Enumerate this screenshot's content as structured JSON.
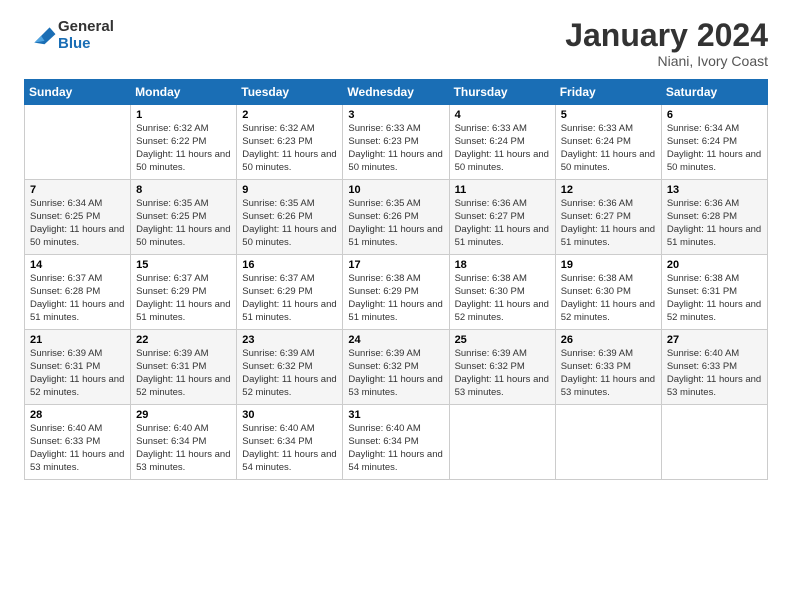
{
  "logo": {
    "general": "General",
    "blue": "Blue"
  },
  "header": {
    "month_year": "January 2024",
    "location": "Niani, Ivory Coast"
  },
  "weekdays": [
    "Sunday",
    "Monday",
    "Tuesday",
    "Wednesday",
    "Thursday",
    "Friday",
    "Saturday"
  ],
  "weeks": [
    [
      {
        "day": "",
        "sunrise": "",
        "sunset": "",
        "daylight": ""
      },
      {
        "day": "1",
        "sunrise": "Sunrise: 6:32 AM",
        "sunset": "Sunset: 6:22 PM",
        "daylight": "Daylight: 11 hours and 50 minutes."
      },
      {
        "day": "2",
        "sunrise": "Sunrise: 6:32 AM",
        "sunset": "Sunset: 6:23 PM",
        "daylight": "Daylight: 11 hours and 50 minutes."
      },
      {
        "day": "3",
        "sunrise": "Sunrise: 6:33 AM",
        "sunset": "Sunset: 6:23 PM",
        "daylight": "Daylight: 11 hours and 50 minutes."
      },
      {
        "day": "4",
        "sunrise": "Sunrise: 6:33 AM",
        "sunset": "Sunset: 6:24 PM",
        "daylight": "Daylight: 11 hours and 50 minutes."
      },
      {
        "day": "5",
        "sunrise": "Sunrise: 6:33 AM",
        "sunset": "Sunset: 6:24 PM",
        "daylight": "Daylight: 11 hours and 50 minutes."
      },
      {
        "day": "6",
        "sunrise": "Sunrise: 6:34 AM",
        "sunset": "Sunset: 6:24 PM",
        "daylight": "Daylight: 11 hours and 50 minutes."
      }
    ],
    [
      {
        "day": "7",
        "sunrise": "Sunrise: 6:34 AM",
        "sunset": "Sunset: 6:25 PM",
        "daylight": "Daylight: 11 hours and 50 minutes."
      },
      {
        "day": "8",
        "sunrise": "Sunrise: 6:35 AM",
        "sunset": "Sunset: 6:25 PM",
        "daylight": "Daylight: 11 hours and 50 minutes."
      },
      {
        "day": "9",
        "sunrise": "Sunrise: 6:35 AM",
        "sunset": "Sunset: 6:26 PM",
        "daylight": "Daylight: 11 hours and 50 minutes."
      },
      {
        "day": "10",
        "sunrise": "Sunrise: 6:35 AM",
        "sunset": "Sunset: 6:26 PM",
        "daylight": "Daylight: 11 hours and 51 minutes."
      },
      {
        "day": "11",
        "sunrise": "Sunrise: 6:36 AM",
        "sunset": "Sunset: 6:27 PM",
        "daylight": "Daylight: 11 hours and 51 minutes."
      },
      {
        "day": "12",
        "sunrise": "Sunrise: 6:36 AM",
        "sunset": "Sunset: 6:27 PM",
        "daylight": "Daylight: 11 hours and 51 minutes."
      },
      {
        "day": "13",
        "sunrise": "Sunrise: 6:36 AM",
        "sunset": "Sunset: 6:28 PM",
        "daylight": "Daylight: 11 hours and 51 minutes."
      }
    ],
    [
      {
        "day": "14",
        "sunrise": "Sunrise: 6:37 AM",
        "sunset": "Sunset: 6:28 PM",
        "daylight": "Daylight: 11 hours and 51 minutes."
      },
      {
        "day": "15",
        "sunrise": "Sunrise: 6:37 AM",
        "sunset": "Sunset: 6:29 PM",
        "daylight": "Daylight: 11 hours and 51 minutes."
      },
      {
        "day": "16",
        "sunrise": "Sunrise: 6:37 AM",
        "sunset": "Sunset: 6:29 PM",
        "daylight": "Daylight: 11 hours and 51 minutes."
      },
      {
        "day": "17",
        "sunrise": "Sunrise: 6:38 AM",
        "sunset": "Sunset: 6:29 PM",
        "daylight": "Daylight: 11 hours and 51 minutes."
      },
      {
        "day": "18",
        "sunrise": "Sunrise: 6:38 AM",
        "sunset": "Sunset: 6:30 PM",
        "daylight": "Daylight: 11 hours and 52 minutes."
      },
      {
        "day": "19",
        "sunrise": "Sunrise: 6:38 AM",
        "sunset": "Sunset: 6:30 PM",
        "daylight": "Daylight: 11 hours and 52 minutes."
      },
      {
        "day": "20",
        "sunrise": "Sunrise: 6:38 AM",
        "sunset": "Sunset: 6:31 PM",
        "daylight": "Daylight: 11 hours and 52 minutes."
      }
    ],
    [
      {
        "day": "21",
        "sunrise": "Sunrise: 6:39 AM",
        "sunset": "Sunset: 6:31 PM",
        "daylight": "Daylight: 11 hours and 52 minutes."
      },
      {
        "day": "22",
        "sunrise": "Sunrise: 6:39 AM",
        "sunset": "Sunset: 6:31 PM",
        "daylight": "Daylight: 11 hours and 52 minutes."
      },
      {
        "day": "23",
        "sunrise": "Sunrise: 6:39 AM",
        "sunset": "Sunset: 6:32 PM",
        "daylight": "Daylight: 11 hours and 52 minutes."
      },
      {
        "day": "24",
        "sunrise": "Sunrise: 6:39 AM",
        "sunset": "Sunset: 6:32 PM",
        "daylight": "Daylight: 11 hours and 53 minutes."
      },
      {
        "day": "25",
        "sunrise": "Sunrise: 6:39 AM",
        "sunset": "Sunset: 6:32 PM",
        "daylight": "Daylight: 11 hours and 53 minutes."
      },
      {
        "day": "26",
        "sunrise": "Sunrise: 6:39 AM",
        "sunset": "Sunset: 6:33 PM",
        "daylight": "Daylight: 11 hours and 53 minutes."
      },
      {
        "day": "27",
        "sunrise": "Sunrise: 6:40 AM",
        "sunset": "Sunset: 6:33 PM",
        "daylight": "Daylight: 11 hours and 53 minutes."
      }
    ],
    [
      {
        "day": "28",
        "sunrise": "Sunrise: 6:40 AM",
        "sunset": "Sunset: 6:33 PM",
        "daylight": "Daylight: 11 hours and 53 minutes."
      },
      {
        "day": "29",
        "sunrise": "Sunrise: 6:40 AM",
        "sunset": "Sunset: 6:34 PM",
        "daylight": "Daylight: 11 hours and 53 minutes."
      },
      {
        "day": "30",
        "sunrise": "Sunrise: 6:40 AM",
        "sunset": "Sunset: 6:34 PM",
        "daylight": "Daylight: 11 hours and 54 minutes."
      },
      {
        "day": "31",
        "sunrise": "Sunrise: 6:40 AM",
        "sunset": "Sunset: 6:34 PM",
        "daylight": "Daylight: 11 hours and 54 minutes."
      },
      {
        "day": "",
        "sunrise": "",
        "sunset": "",
        "daylight": ""
      },
      {
        "day": "",
        "sunrise": "",
        "sunset": "",
        "daylight": ""
      },
      {
        "day": "",
        "sunrise": "",
        "sunset": "",
        "daylight": ""
      }
    ]
  ]
}
